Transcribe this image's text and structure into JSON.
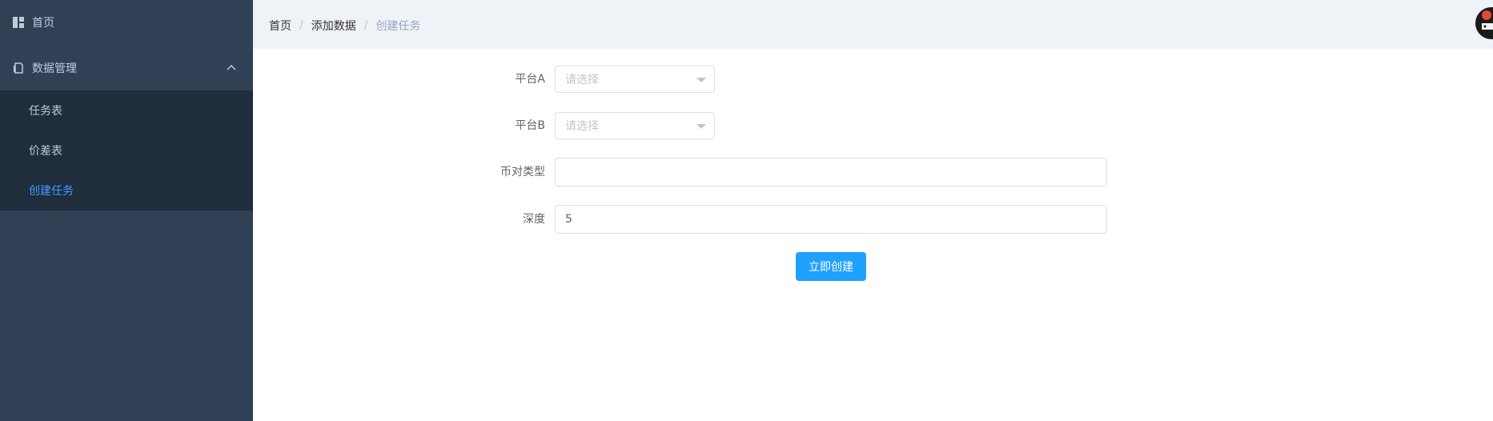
{
  "sidebar": {
    "home_label": "首页",
    "data_mgmt_label": "数据管理",
    "submenu": [
      {
        "label": "任务表"
      },
      {
        "label": "价差表"
      },
      {
        "label": "创建任务"
      }
    ]
  },
  "header": {
    "breadcrumb": [
      "首页",
      "添加数据",
      "创建任务"
    ],
    "separator": "/"
  },
  "form": {
    "platform_a": {
      "label": "平台A",
      "placeholder": "请选择"
    },
    "platform_b": {
      "label": "平台B",
      "placeholder": "请选择"
    },
    "pair_type": {
      "label": "币对类型",
      "value": ""
    },
    "depth": {
      "label": "深度",
      "value": "5"
    },
    "submit_label": "立即创建"
  },
  "colors": {
    "sidebar_bg": "#304156",
    "submenu_bg": "#1f2d3d",
    "active": "#409eff",
    "button": "#20a0ff"
  }
}
